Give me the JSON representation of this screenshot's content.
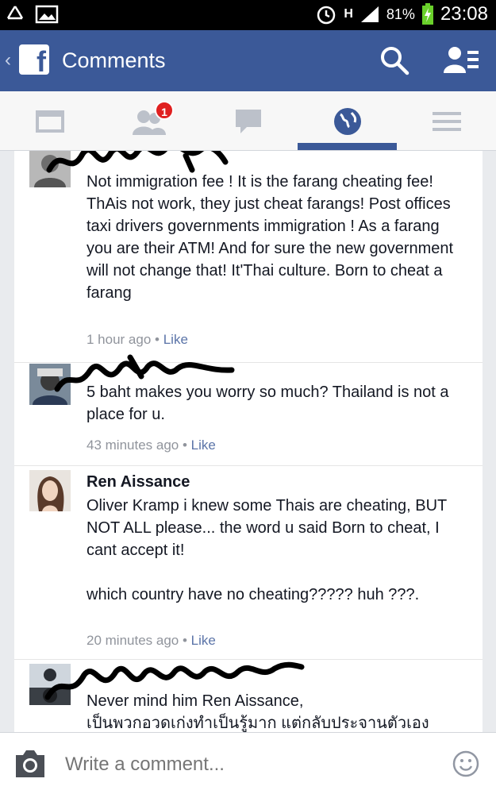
{
  "status_bar": {
    "network": "H",
    "battery": "81%",
    "time": "23:08"
  },
  "app_bar": {
    "title": "Comments",
    "brand_color": "#3b5998"
  },
  "nav": {
    "tabs": [
      {
        "icon": "news-feed-icon"
      },
      {
        "icon": "friend-requests-icon",
        "badge": "1"
      },
      {
        "icon": "messages-icon"
      },
      {
        "icon": "notifications-globe-icon",
        "active": true
      },
      {
        "icon": "menu-icon"
      }
    ]
  },
  "comments": [
    {
      "name": "",
      "text": "Not immigration fee ! It is the farang cheating fee!  ThAis not work, they just cheat farangs! Post offices taxi drivers governments immigration ! As a farang you are their ATM! And for sure the new government will not change that! It'Thai culture. Born to cheat a farang",
      "time": "1 hour ago",
      "like": "Like",
      "name_scribbled": true
    },
    {
      "name": "",
      "text": "5 baht makes you worry so much? Thailand is not a place for u.",
      "time": "43 minutes ago",
      "like": "Like",
      "name_scribbled": true
    },
    {
      "name": "Ren Aissance",
      "text": "Oliver Kramp  i knew some Thais are cheating, BUT NOT ALL please... the word u said Born to cheat, I cant accept it!\n\nwhich country have no cheating????? huh ???.",
      "time": "20 minutes ago",
      "like": "Like"
    },
    {
      "name": "",
      "text": "Never mind him Ren Aissance,\nเป็นพวกอวดเก่งทำเป็นรู้มาก แต่กลับประจานตัวเอง",
      "name_scribbled": true
    }
  ],
  "composer": {
    "placeholder": "Write a comment..."
  }
}
